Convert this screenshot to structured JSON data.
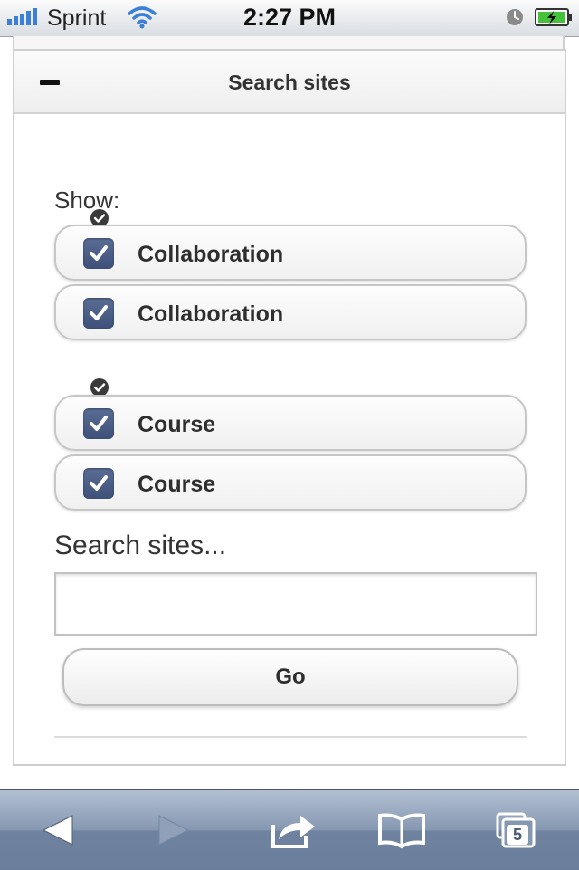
{
  "status_bar": {
    "carrier": "Sprint",
    "time": "2:27 PM",
    "icons": [
      "signal-icon",
      "wifi-icon",
      "alarm-icon",
      "battery-charging-icon"
    ]
  },
  "collapsible": {
    "title": "Search sites",
    "icon": "minus-icon",
    "state": "expanded"
  },
  "filters": {
    "label": "Show:",
    "options": [
      {
        "label": "Collaboration",
        "checked": true
      },
      {
        "label": "Collaboration",
        "checked": true
      },
      {
        "label": "Course",
        "checked": true
      },
      {
        "label": "Course",
        "checked": true
      }
    ]
  },
  "search": {
    "label": "Search sites...",
    "value": "",
    "placeholder": "",
    "button_label": "Go"
  },
  "toolbar": {
    "tab_count": "5",
    "buttons": [
      "back-icon",
      "forward-icon",
      "share-icon",
      "bookmarks-icon",
      "tabs-icon"
    ]
  },
  "colors": {
    "checkbox": "#4a5c85",
    "toolbar": "#8597b1",
    "status_bar": "#e6e9ed"
  }
}
